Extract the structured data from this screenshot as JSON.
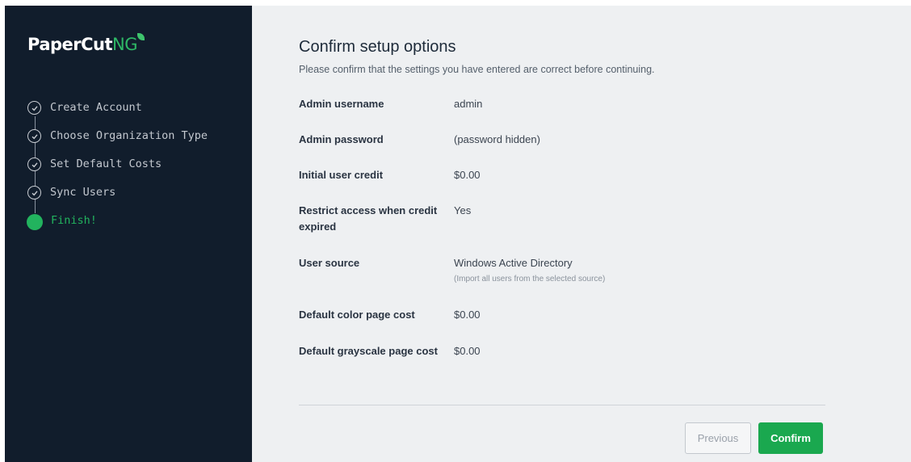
{
  "brand": {
    "name_main": "PaperCut",
    "name_suffix": "NG"
  },
  "steps": [
    {
      "label": "Create Account",
      "state": "done"
    },
    {
      "label": "Choose Organization Type",
      "state": "done"
    },
    {
      "label": "Set Default Costs",
      "state": "done"
    },
    {
      "label": "Sync Users",
      "state": "done"
    },
    {
      "label": "Finish!",
      "state": "active"
    }
  ],
  "page": {
    "title": "Confirm setup options",
    "subtitle": "Please confirm that the settings you have entered are correct before continuing."
  },
  "settings": [
    {
      "label": "Admin username",
      "value": "admin"
    },
    {
      "label": "Admin password",
      "value": "(password hidden)"
    },
    {
      "label": "Initial user credit",
      "value": "$0.00"
    },
    {
      "label": "Restrict access when credit expired",
      "value": "Yes"
    },
    {
      "label": "User source",
      "value": "Windows Active Directory",
      "hint": "(Import all users from the selected source)"
    },
    {
      "label": "Default color page cost",
      "value": "$0.00"
    },
    {
      "label": "Default grayscale page cost",
      "value": "$0.00"
    }
  ],
  "buttons": {
    "previous": "Previous",
    "confirm": "Confirm"
  },
  "colors": {
    "sidebar_bg": "#111d2c",
    "accent_green": "#1aa84f",
    "main_bg": "#eef0f2"
  },
  "icons": {
    "completed_step": "check-circle-icon",
    "active_step": "filled-circle-icon"
  }
}
